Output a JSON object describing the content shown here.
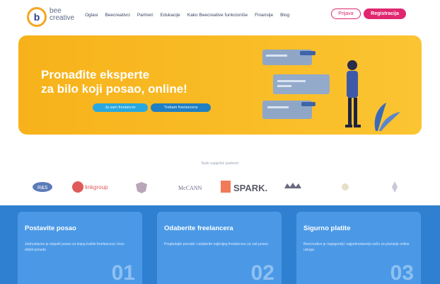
{
  "brand": {
    "badge": "b",
    "line1": "bee",
    "line2": "creative",
    "accent": "#f5a623",
    "primary": "#e0266e"
  },
  "nav": [
    "Oglasi",
    "Beecreativci",
    "Partneri",
    "Edukacije",
    "Kako Beecreative funkcioniše",
    "Finansije",
    "Blog"
  ],
  "auth": {
    "login": "Prijava",
    "register": "Registracija"
  },
  "hero": {
    "title_line1": "Pronađite eksperte",
    "title_line2": "za bilo koji posao, online!",
    "btn_primary": "Ja sam freelancer",
    "btn_secondary": "Trebam freelancera"
  },
  "partners": {
    "label": "Naši uspješni partneri",
    "logos": [
      "R&S",
      "linkgroup",
      "shield-logo",
      "McCANN",
      "SPARK.",
      "crown-logo",
      "flower-logo",
      "figure-logo"
    ]
  },
  "features": [
    {
      "title": "Postavite posao",
      "desc": "Jednostavno je objaviti posao za kojeg tražite freelancera i brzo dobiti ponude.",
      "num": "01"
    },
    {
      "title": "Odaberite freelancera",
      "desc": "Pregledajte ponude i odaberite najboljeg freelancera za vaš posao.",
      "num": "02"
    },
    {
      "title": "Sigurno platite",
      "desc": "Beecreative je najsigurniji i najjednostavniji način za plaćanje online usluga.",
      "num": "03"
    }
  ]
}
